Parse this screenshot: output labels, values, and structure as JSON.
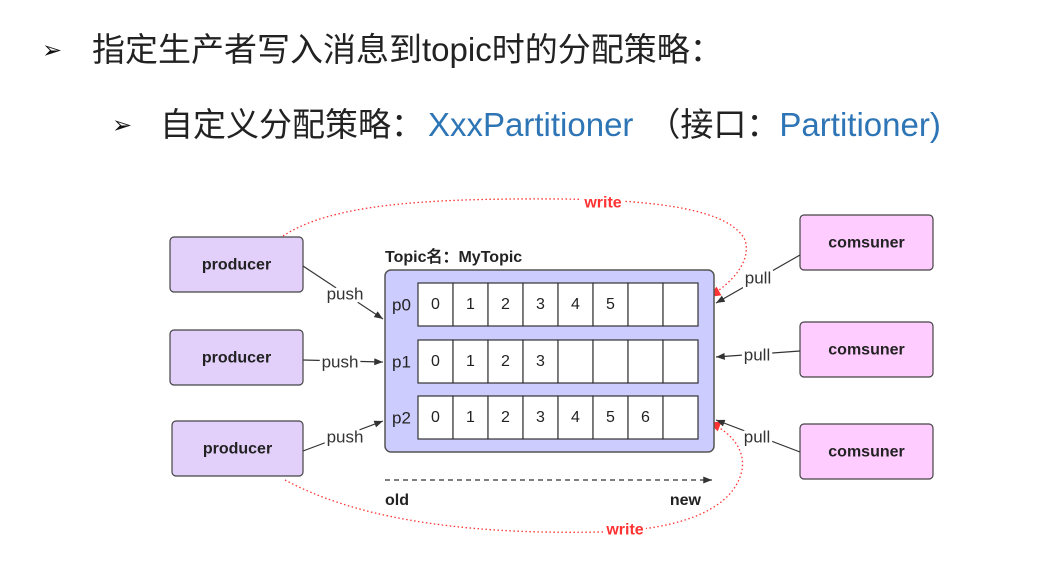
{
  "slide": {
    "bullet_marker": "➢",
    "heading": "指定生产者写入消息到topic时的分配策略：",
    "subpoint": {
      "label": "自定义分配策略：",
      "class_name": "XxxPartitioner",
      "interface_prefix": "（接口：",
      "interface_name": "Partitioner)"
    }
  },
  "diagram": {
    "topic_label": "Topic名：MyTopic",
    "producers": [
      {
        "label": "producer",
        "arrow_label": "push"
      },
      {
        "label": "producer",
        "arrow_label": "push"
      },
      {
        "label": "producer",
        "arrow_label": "push"
      }
    ],
    "consumers": [
      {
        "label": "comsuner",
        "arrow_label": "pull"
      },
      {
        "label": "comsuner",
        "arrow_label": "pull"
      },
      {
        "label": "comsuner",
        "arrow_label": "pull"
      }
    ],
    "partitions": [
      {
        "name": "p0",
        "offsets": [
          "0",
          "1",
          "2",
          "3",
          "4",
          "5"
        ]
      },
      {
        "name": "p1",
        "offsets": [
          "0",
          "1",
          "2",
          "3"
        ]
      },
      {
        "name": "p2",
        "offsets": [
          "0",
          "1",
          "2",
          "3",
          "4",
          "5",
          "6"
        ]
      }
    ],
    "write_labels": [
      "write",
      "write"
    ],
    "order_axis": {
      "start_label": "old",
      "end_label": "new"
    }
  },
  "colors": {
    "text": "#222222",
    "accent_blue": "#2e75b6",
    "write_red": "#ff3333",
    "producer_fill": "#e2d0fa",
    "consumer_fill": "#ffccff",
    "topic_fill": "#ccccff",
    "cell_fill": "#ffffff"
  }
}
